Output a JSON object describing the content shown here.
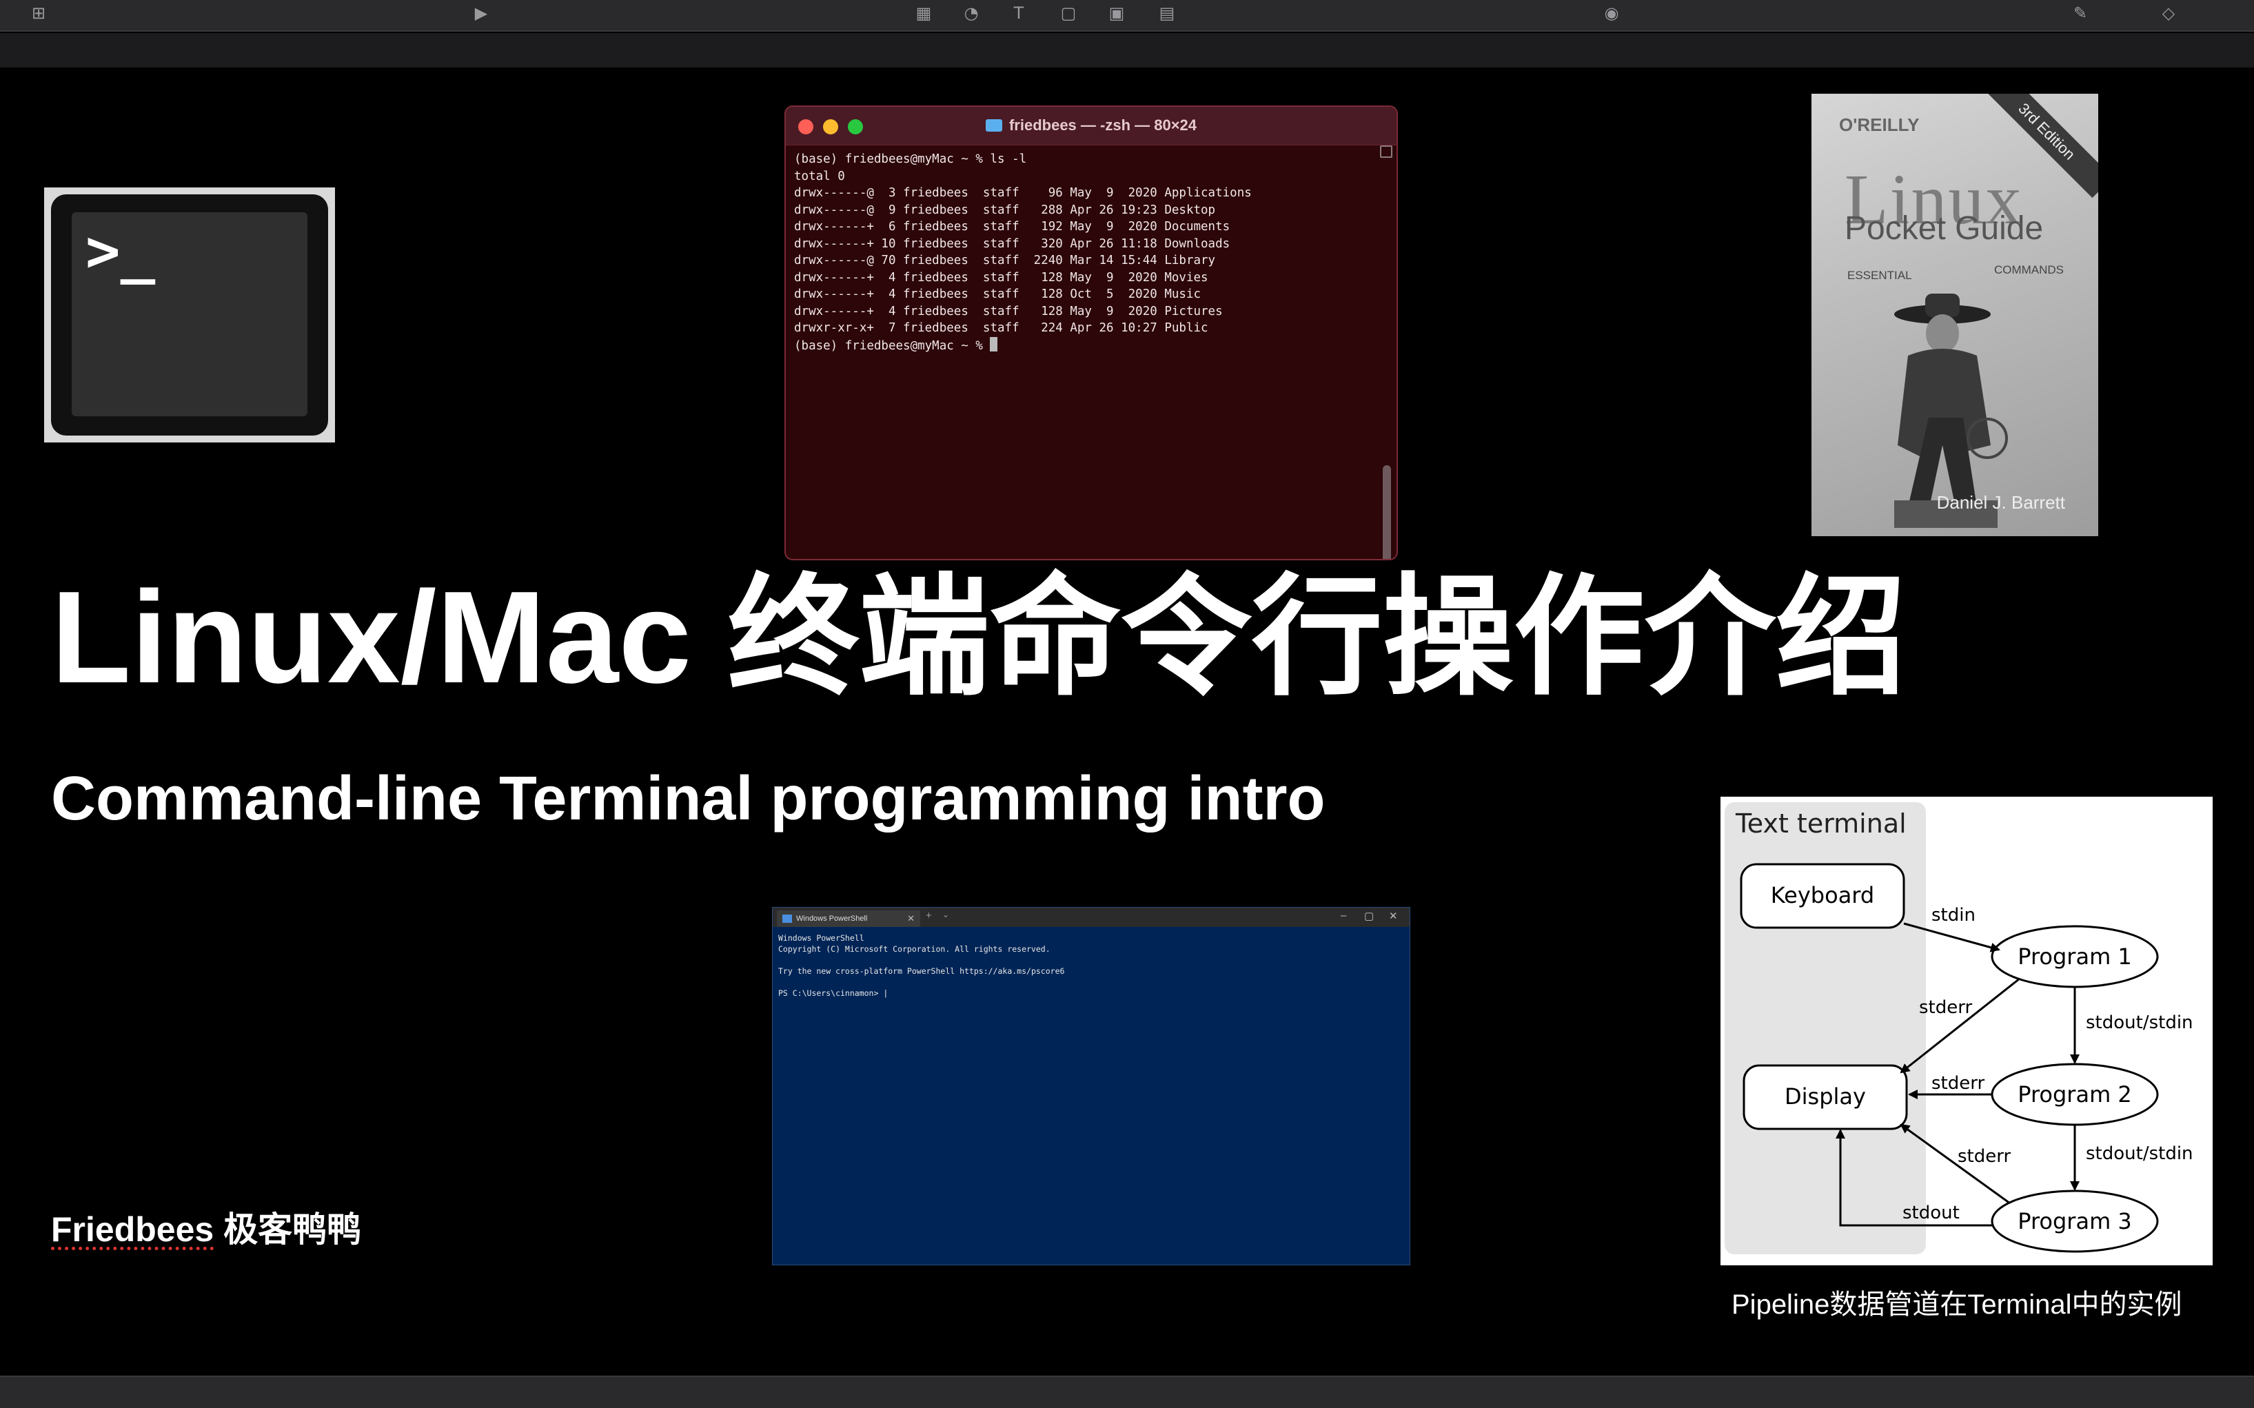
{
  "toolbar": {
    "icons": [
      "add-slide-icon",
      "play-icon",
      "table-icon",
      "chart-icon",
      "text-icon",
      "shape-icon",
      "media-icon",
      "comment-icon",
      "collaborate-icon",
      "format-icon",
      "animate-icon"
    ]
  },
  "slide": {
    "title_latin": "Linux/Mac ",
    "title_cjk": "终端命令行操作介绍",
    "subtitle": "Command-line Terminal programming intro",
    "author_name": "Friedbees",
    "author_suffix": " 极客鸭鸭",
    "caption": "Pipeline数据管道在Terminal中的实例"
  },
  "terminal_icon": {
    "prompt": ">_"
  },
  "mac_terminal": {
    "title": "friedbees — -zsh — 80×24",
    "lines": [
      "(base) friedbees@myMac ~ % ls -l",
      "total 0",
      "drwx------@  3 friedbees  staff    96 May  9  2020 Applications",
      "drwx------@  9 friedbees  staff   288 Apr 26 19:23 Desktop",
      "drwx------+  6 friedbees  staff   192 May  9  2020 Documents",
      "drwx------+ 10 friedbees  staff   320 Apr 26 11:18 Downloads",
      "drwx------@ 70 friedbees  staff  2240 Mar 14 15:44 Library",
      "drwx------+  4 friedbees  staff   128 May  9  2020 Movies",
      "drwx------+  4 friedbees  staff   128 Oct  5  2020 Music",
      "drwx------+  4 friedbees  staff   128 May  9  2020 Pictures",
      "drwxr-xr-x+  7 friedbees  staff   224 Apr 26 10:27 Public"
    ],
    "prompt": "(base) friedbees@myMac ~ % "
  },
  "book": {
    "publisher": "O'REILLY",
    "edition": "3rd Edition",
    "title": "Linux",
    "subtitle": "Pocket Guide",
    "tag_left": "ESSENTIAL",
    "tag_right": "COMMANDS",
    "author": "Daniel J. Barrett"
  },
  "powershell": {
    "tab_title": "Windows PowerShell",
    "lines": [
      "Windows PowerShell",
      "Copyright (C) Microsoft Corporation. All rights reserved.",
      "",
      "Try the new cross-platform PowerShell https://aka.ms/pscore6",
      "",
      "PS C:\\Users\\cinnamon> |"
    ]
  },
  "diagram": {
    "group_label": "Text terminal",
    "nodes": {
      "keyboard": "Keyboard",
      "display": "Display",
      "program1": "Program 1",
      "program2": "Program 2",
      "program3": "Program 3"
    },
    "edges": {
      "kb_p1": "stdin",
      "p1_disp": "stderr",
      "p1_p2": "stdout/stdin",
      "p2_disp": "stderr",
      "p2_p3": "stdout/stdin",
      "p3_disp_err": "stderr",
      "p3_disp_out": "stdout"
    }
  }
}
